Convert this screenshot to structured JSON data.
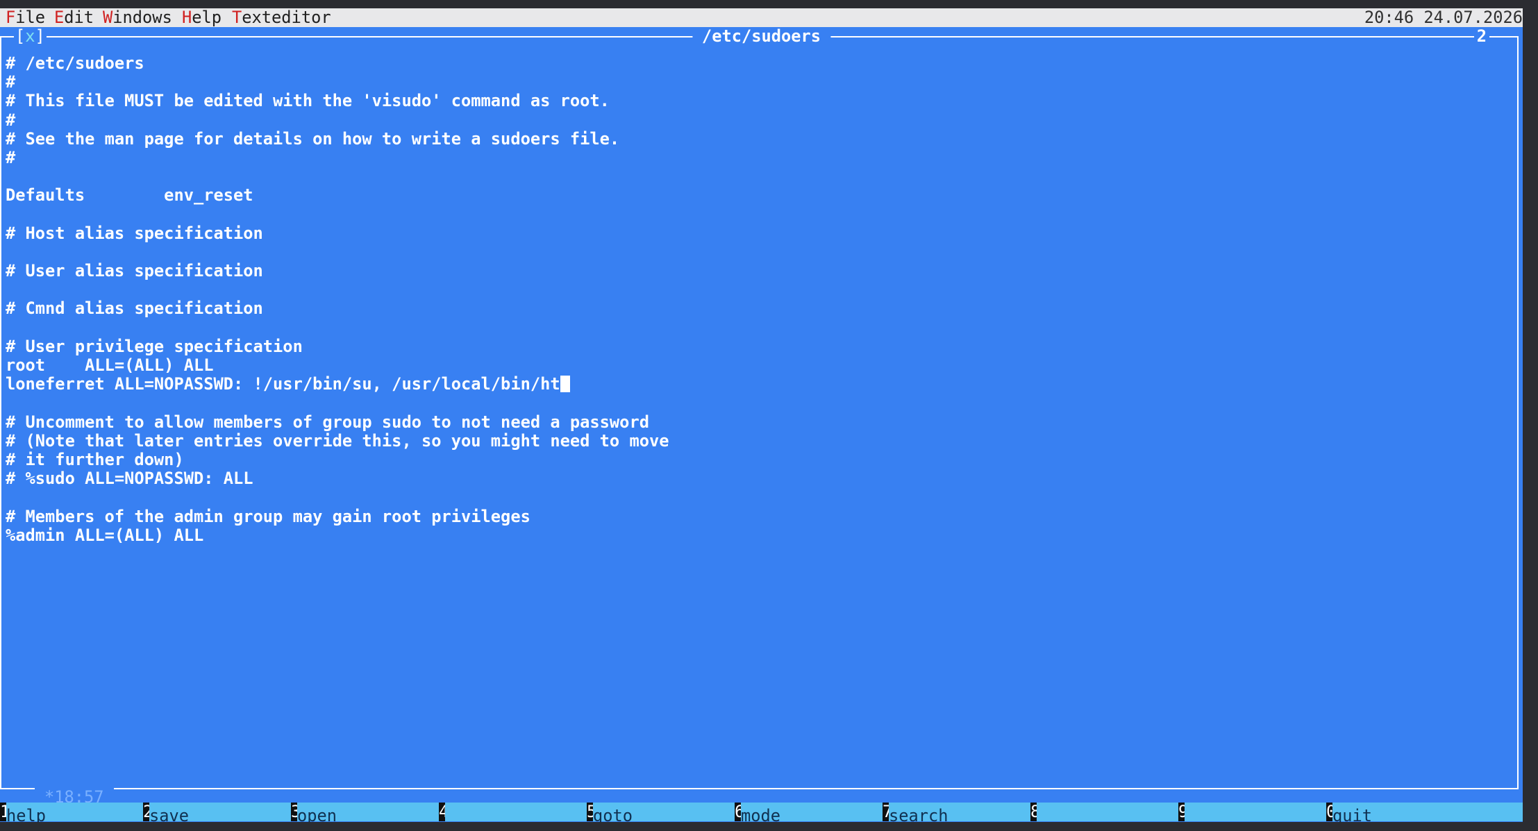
{
  "menubar": {
    "items": [
      {
        "key": "F",
        "rest": "ile"
      },
      {
        "key": "E",
        "rest": "dit"
      },
      {
        "key": "W",
        "rest": "indows"
      },
      {
        "key": "H",
        "rest": "elp"
      },
      {
        "key": "T",
        "rest": "exteditor"
      }
    ],
    "clock": "20:46 24.07.2026"
  },
  "window": {
    "title": "/etc/sudoers",
    "close_left": "[",
    "close_x": "x",
    "close_right": "]",
    "number": "2",
    "status": "*18:57"
  },
  "editor": {
    "lines": [
      "# /etc/sudoers",
      "#",
      "# This file MUST be edited with the 'visudo' command as root.",
      "#",
      "# See the man page for details on how to write a sudoers file.",
      "#",
      "",
      "Defaults        env_reset",
      "",
      "# Host alias specification",
      "",
      "# User alias specification",
      "",
      "# Cmnd alias specification",
      "",
      "# User privilege specification",
      "root    ALL=(ALL) ALL",
      "loneferret ALL=NOPASSWD: !/usr/bin/su, /usr/local/bin/ht",
      "",
      "# Uncomment to allow members of group sudo to not need a password",
      "# (Note that later entries override this, so you might need to move",
      "# it further down)",
      "# %sudo ALL=NOPASSWD: ALL",
      "",
      "# Members of the admin group may gain root privileges",
      "%admin ALL=(ALL) ALL"
    ]
  },
  "fkeys": [
    {
      "num": "1",
      "label": "help"
    },
    {
      "num": "2",
      "label": "save"
    },
    {
      "num": "3",
      "label": "open"
    },
    {
      "num": "4",
      "label": ""
    },
    {
      "num": "5",
      "label": "goto"
    },
    {
      "num": "6",
      "label": "mode"
    },
    {
      "num": "7",
      "label": "search"
    },
    {
      "num": "8",
      "label": ""
    },
    {
      "num": "9",
      "label": ""
    },
    {
      "num": "0",
      "label": "quit"
    }
  ],
  "colors": {
    "background": "#3880f2",
    "menubar": "#e8e8ea",
    "menu_hotkey": "#d02020",
    "fkeybar": "#58c0f2"
  }
}
